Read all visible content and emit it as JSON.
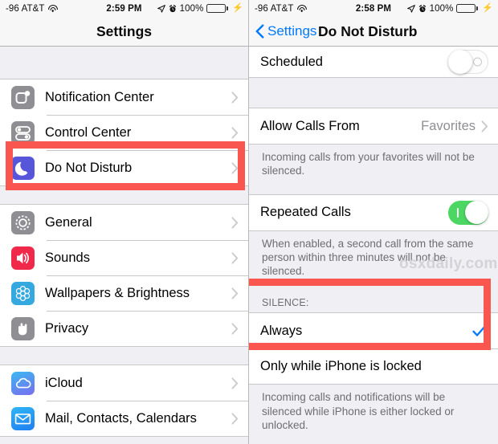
{
  "left": {
    "statusbar": {
      "carrier": "-96 AT&T",
      "wifi_icon": "wifi-icon",
      "time": "2:59 PM",
      "location_icon": "location-arrow-icon",
      "alarm_icon": "alarm-clock-icon",
      "battery_percent": "100%",
      "battery_icon": "battery-icon",
      "charging_icon": "charging-bolt-icon"
    },
    "navbar": {
      "title": "Settings"
    },
    "groups": [
      {
        "rows": [
          {
            "label": "Notification Center",
            "icon": "notification-center-icon",
            "accessory": "chevron"
          },
          {
            "label": "Control Center",
            "icon": "control-center-icon",
            "accessory": "chevron"
          },
          {
            "label": "Do Not Disturb",
            "icon": "do-not-disturb-moon-icon",
            "accessory": "chevron",
            "highlighted": true
          }
        ]
      },
      {
        "rows": [
          {
            "label": "General",
            "icon": "gear-icon",
            "accessory": "chevron"
          },
          {
            "label": "Sounds",
            "icon": "speaker-icon",
            "accessory": "chevron"
          },
          {
            "label": "Wallpapers & Brightness",
            "icon": "wallpaper-flower-icon",
            "accessory": "chevron"
          },
          {
            "label": "Privacy",
            "icon": "privacy-hand-icon",
            "accessory": "chevron"
          }
        ]
      },
      {
        "rows": [
          {
            "label": "iCloud",
            "icon": "icloud-cloud-icon",
            "accessory": "chevron"
          },
          {
            "label": "Mail, Contacts, Calendars",
            "icon": "mail-envelope-icon",
            "accessory": "chevron"
          }
        ]
      }
    ]
  },
  "right": {
    "statusbar": {
      "carrier": "-96 AT&T",
      "wifi_icon": "wifi-icon",
      "time": "2:58 PM",
      "location_icon": "location-arrow-icon",
      "alarm_icon": "alarm-clock-icon",
      "battery_percent": "100%",
      "battery_icon": "battery-icon",
      "charging_icon": "charging-bolt-icon"
    },
    "navbar": {
      "back_label": "Settings",
      "back_icon": "chevron-left-icon",
      "title": "Do Not Disturb"
    },
    "scheduled": {
      "label": "Scheduled",
      "toggle_state": "off"
    },
    "allow_calls": {
      "label": "Allow Calls From",
      "value": "Favorites",
      "accessory": "chevron"
    },
    "allow_calls_footer": "Incoming calls from your favorites will not be silenced.",
    "repeated_calls": {
      "label": "Repeated Calls",
      "toggle_state": "on"
    },
    "repeated_calls_footer": "When enabled, a second call from the same person within three minutes will not be silenced.",
    "watermark": "osxdaily.com",
    "silence": {
      "header": "SILENCE:",
      "options": [
        {
          "label": "Always",
          "checked": true,
          "highlighted": true
        },
        {
          "label": "Only while iPhone is locked",
          "checked": false
        }
      ],
      "footer": "Incoming calls and notifications will be silenced while iPhone is either locked or unlocked."
    }
  },
  "colors": {
    "annotation_red": "#f9564f",
    "accent_blue": "#0079ff",
    "toggle_on_green": "#4cd763",
    "checkmark_blue": "#007aff",
    "battery_green": "#34d24a"
  }
}
